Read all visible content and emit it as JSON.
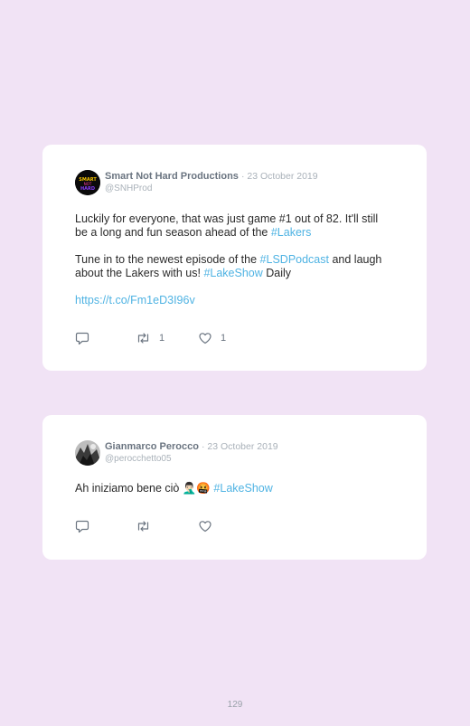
{
  "tweets": [
    {
      "author": "Smart Not Hard Productions",
      "date": "· 23 October 2019",
      "handle": "@SNHProd",
      "avatar_text": "SMART NOT HARD",
      "p1_text": "Luckily for everyone, that was just game #1 out of 82. It'll still be a long and fun season ahead of the ",
      "p1_tag": "#Lakers",
      "p2_text1": "Tune in to the newest episode of the ",
      "p2_tag1": "#LSDPodcast",
      "p2_text2": " and laugh about the Lakers with us! ",
      "p2_tag2": "#LakeShow",
      "p2_text3": " Daily",
      "link": "https://t.co/Fm1eD3I96v",
      "retweets": "1",
      "likes": "1"
    },
    {
      "author": "Gianmarco Perocco",
      "date": "· 23 October 2019",
      "handle": "@perocchetto05",
      "text": "Ah iniziamo bene ciò 🤦🏻‍♂️🤬 ",
      "tag": "#LakeShow"
    }
  ],
  "icons": {
    "reply": "reply-icon",
    "retweet": "retweet-icon",
    "like": "heart-icon"
  },
  "colors": {
    "background": "#f1e3f5",
    "hashtag": "#4fb3e3",
    "meta": "#a9b1b9"
  },
  "page_number": "129"
}
